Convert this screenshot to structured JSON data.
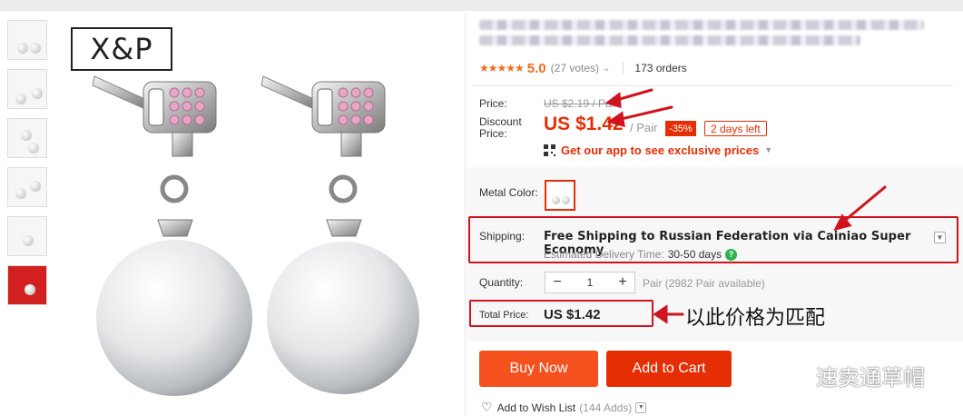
{
  "gallery": {
    "thumbnails": [
      "thumb-1",
      "thumb-2",
      "thumb-3",
      "thumb-4",
      "thumb-5",
      "thumb-6"
    ],
    "logo_text": "X&P"
  },
  "product": {
    "rating_score": "5.0",
    "votes": "(27 votes)",
    "orders": "173 orders"
  },
  "pricing": {
    "price_label": "Price:",
    "original_price": "US $2.19 / Pair",
    "discount_label": "Discount Price:",
    "discount_price": "US $1.42",
    "per_unit": "/ Pair",
    "discount_pct": "-35%",
    "days_left": "2 days left",
    "app_promo": "Get our app to see exclusive prices"
  },
  "options": {
    "metal_color_label": "Metal Color:"
  },
  "shipping": {
    "label": "Shipping:",
    "method": "Free Shipping to Russian Federation via Cainiao Super Economy",
    "estimate_label": "Estimated Delivery Time:",
    "estimate_value": "30-50 days"
  },
  "quantity": {
    "label": "Quantity:",
    "value": "1",
    "availability": "Pair (2982 Pair available)"
  },
  "total": {
    "label": "Total Price:",
    "value": "US $1.42"
  },
  "actions": {
    "buy_now": "Buy Now",
    "add_to_cart": "Add to Cart",
    "wishlist": "Add to Wish List",
    "wishlist_adds": "(144 Adds)"
  },
  "annotation": {
    "note": "以此价格为匹配",
    "color": "#d0141f"
  },
  "watermark": {
    "text": "速卖通草帽"
  },
  "colors": {
    "accent_red": "#e62e04",
    "buy_orange": "#f4511e",
    "star_orange": "#f36a1a"
  }
}
